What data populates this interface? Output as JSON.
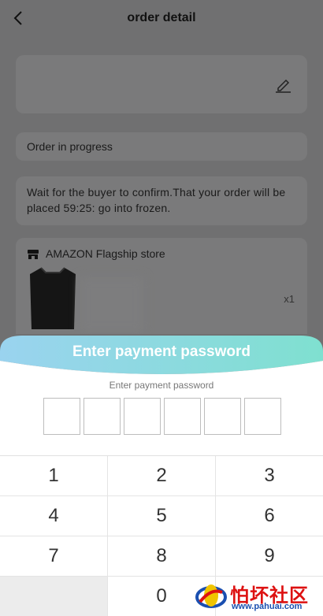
{
  "header": {
    "title": "order detail"
  },
  "status": {
    "text": "Order in progress"
  },
  "notice": {
    "text": "Wait for the buyer to confirm.That your order will be placed 59:25: go into frozen."
  },
  "store": {
    "name": "AMAZON Flagship store",
    "quantity": "x1"
  },
  "payment": {
    "title": "Enter payment password",
    "subtitle": "Enter payment password",
    "digits_entered": 0,
    "digit_slots": 6
  },
  "keypad": {
    "keys": [
      "1",
      "2",
      "3",
      "4",
      "5",
      "6",
      "7",
      "8",
      "9",
      "",
      "0",
      ""
    ]
  },
  "watermark": {
    "text": "怕坏社区",
    "url": "www.pahuai.com"
  },
  "colors": {
    "header_gradient_start": "#9ad3ef",
    "header_gradient_end": "#7fe0d0",
    "overlay": "#707071"
  }
}
